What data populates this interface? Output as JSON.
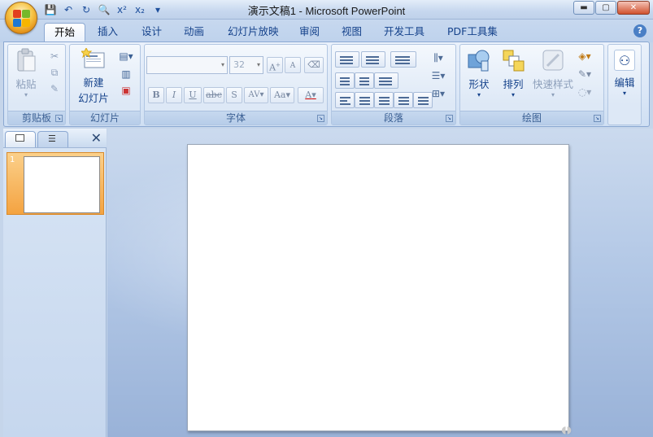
{
  "window": {
    "title": "演示文稿1 - Microsoft PowerPoint",
    "min_icon": "▬",
    "max_icon": "▢",
    "close_icon": "✕"
  },
  "qat": [
    {
      "name": "save-icon",
      "glyph": "💾"
    },
    {
      "name": "undo-icon",
      "glyph": "↶"
    },
    {
      "name": "redo-icon",
      "glyph": "↻"
    },
    {
      "name": "print-preview-icon",
      "glyph": "🔍"
    },
    {
      "name": "superscript-icon",
      "glyph": "x²"
    },
    {
      "name": "subscript-icon",
      "glyph": "x₂"
    },
    {
      "name": "customize-qat-icon",
      "glyph": "▾"
    }
  ],
  "tabs": [
    "开始",
    "插入",
    "设计",
    "动画",
    "幻灯片放映",
    "审阅",
    "视图",
    "开发工具",
    "PDF工具集"
  ],
  "active_tab": "开始",
  "help": "?",
  "groups": {
    "clipboard": {
      "label": "剪贴板",
      "paste": "粘贴"
    },
    "slides": {
      "label": "幻灯片",
      "new_slide_line1": "新建",
      "new_slide_line2": "幻灯片"
    },
    "font": {
      "label": "字体",
      "font_size": "32",
      "bold": "B",
      "italic": "I",
      "underline": "U",
      "strike": "abc",
      "shadow": "S",
      "spacing": "AV",
      "case": "Aa",
      "color": "A",
      "grow": "A",
      "shrink": "A"
    },
    "paragraph": {
      "label": "段落"
    },
    "drawing": {
      "label": "绘图",
      "shapes": "形状",
      "arrange": "排列",
      "quick_styles": "快速样式"
    },
    "editing": {
      "label": "编辑"
    }
  },
  "slides_pane": {
    "close": "✕",
    "thumbnails": [
      {
        "number": "1"
      }
    ]
  },
  "colors": {
    "accent_orange": "#f4a341",
    "ribbon_blue": "#15428b",
    "workspace_blue": "#99b2d8"
  }
}
